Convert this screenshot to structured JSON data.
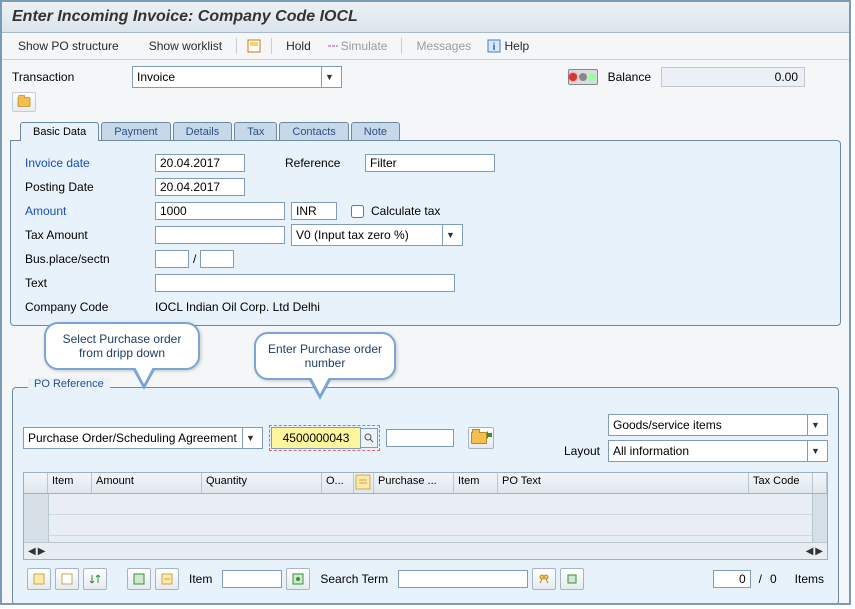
{
  "title": "Enter Incoming Invoice: Company Code IOCL",
  "toolbar": {
    "show_po_structure": "Show PO structure",
    "show_worklist": "Show worklist",
    "hold": "Hold",
    "simulate": "Simulate",
    "messages": "Messages",
    "help": "Help"
  },
  "header": {
    "transaction_label": "Transaction",
    "transaction_value": "Invoice",
    "balance_label": "Balance",
    "balance_value": "0.00"
  },
  "tabs": [
    "Basic Data",
    "Payment",
    "Details",
    "Tax",
    "Contacts",
    "Note"
  ],
  "basic": {
    "invoice_date_label": "Invoice date",
    "invoice_date": "20.04.2017",
    "reference_label": "Reference",
    "reference_value": "Filter",
    "posting_date_label": "Posting Date",
    "posting_date": "20.04.2017",
    "amount_label": "Amount",
    "amount": "1000",
    "currency": "INR",
    "calculate_tax_label": "Calculate tax",
    "tax_amount_label": "Tax Amount",
    "tax_code_value": "V0 (Input tax zero %)",
    "bus_place_label": "Bus.place/sectn",
    "bus_sep": "/",
    "text_label": "Text",
    "company_label": "Company Code",
    "company_value": "IOCL  Indian Oil Corp. Ltd Delhi"
  },
  "po": {
    "section_title": "PO Reference",
    "ref_type": "Purchase Order/Scheduling Agreement",
    "po_number": "4500000043",
    "layout_label": "Layout",
    "goods_select": "Goods/service items",
    "layout_select": "All information",
    "columns": [
      "Item",
      "Amount",
      "Quantity",
      "O...",
      "",
      "Purchase ...",
      "Item",
      "PO Text",
      "Tax Code"
    ]
  },
  "footer": {
    "item_label": "Item",
    "search_label": "Search Term",
    "paging_current": "0",
    "paging_sep": "/",
    "paging_total": "0",
    "items_label": "Items"
  },
  "callouts": {
    "dropdown": "Select Purchase order from dripp down",
    "number": "Enter Purchase order number"
  }
}
